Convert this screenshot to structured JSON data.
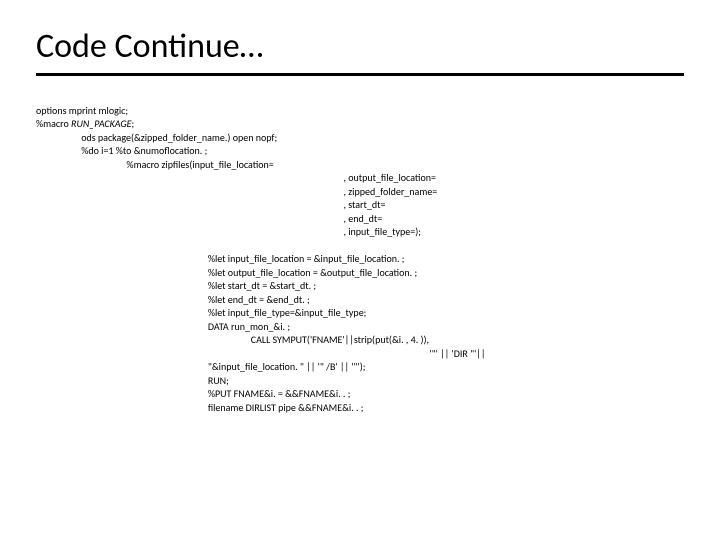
{
  "title": "Code Continue…",
  "code": {
    "l01": "options mprint mlogic;",
    "l02a": "%macro ",
    "l02b": "RUN_PACKAGE",
    "l02c": ";",
    "l03": "                    ods package(&zipped_folder_name.) open nopf;",
    "l04": "                    %do i=1 %to &numoflocation. ;",
    "l05": "                                        %macro zipfiles(input_file_location=",
    "l06": "                                                                                                                                        , output_file_location=",
    "l07": "                                                                                                                                        , zipped_folder_name=",
    "l08": "                                                                                                                                        , start_dt=",
    "l09": "                                                                                                                                        , end_dt=",
    "l10": "                                                                                                                                        , input_file_type=);",
    "l11": " ",
    "l12": "                                                                            %let input_file_location = &input_file_location. ;",
    "l13": "                                                                            %let output_file_location = &output_file_location. ;",
    "l14": "                                                                            %let start_dt = &start_dt. ;",
    "l15": "                                                                            %let end_dt = &end_dt. ;",
    "l16": "                                                                            %let input_file_type=&input_file_type;",
    "l17": "                                                                            DATA run_mon_&i. ;",
    "l18": "                                                                                               CALL SYMPUT('FNAME'||strip(put(&i. , 4. )),",
    "l19": "                                                                                                                                                                              '\"' || 'DIR \"'||",
    "l20": "                                                                            \"&input_file_location. \" || '\" /B' || '\"');",
    "l21": "                                                                            RUN;",
    "l22": "                                                                            %PUT FNAME&i. = &&FNAME&i. . ;",
    "l23": "                                                                            filename DIRLIST pipe &&FNAME&i. . ;"
  }
}
